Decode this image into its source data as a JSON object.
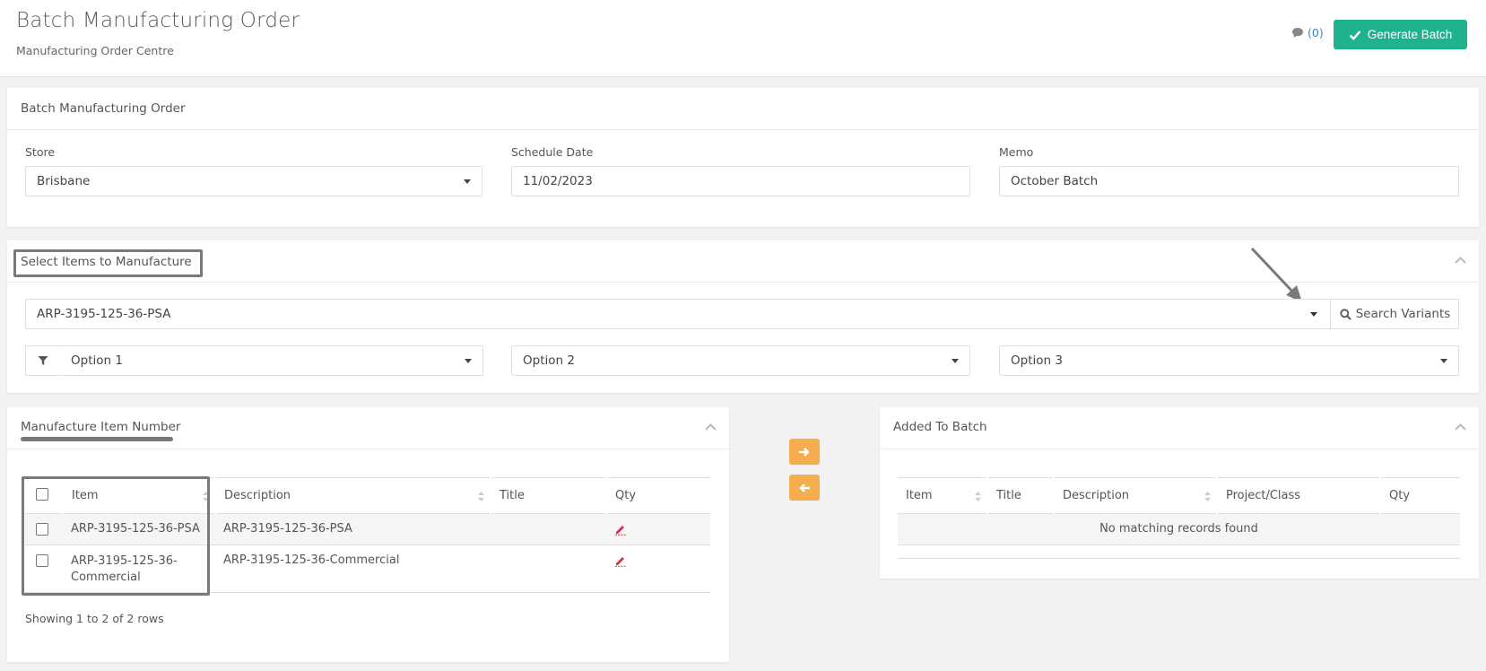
{
  "header": {
    "title": "Batch Manufacturing Order",
    "subtitle": "Manufacturing Order Centre",
    "comments_label": "(0)",
    "generate_label": "Generate Batch"
  },
  "order_panel": {
    "title": "Batch Manufacturing Order",
    "store_label": "Store",
    "store_value": "Brisbane",
    "date_label": "Schedule Date",
    "date_value": "11/02/2023",
    "memo_label": "Memo",
    "memo_value": "October Batch"
  },
  "select_panel": {
    "title": "Select Items to Manufacture",
    "search_value": "ARP-3195-125-36-PSA",
    "search_button": "Search Variants",
    "option1": "Option 1",
    "option2": "Option 2",
    "option3": "Option 3"
  },
  "manufacture_panel": {
    "title": "Manufacture Item Number",
    "columns": [
      "Item",
      "Description",
      "Title",
      "Qty"
    ],
    "rows": [
      {
        "item": "ARP-3195-125-36-PSA",
        "description": "ARP-3195-125-36-PSA",
        "title": ""
      },
      {
        "item": "ARP-3195-125-36-Commercial",
        "description": "ARP-3195-125-36-Commercial",
        "title": ""
      }
    ],
    "footer": "Showing 1 to 2 of 2 rows"
  },
  "batch_panel": {
    "title": "Added To Batch",
    "columns": [
      "Item",
      "Title",
      "Description",
      "Project/Class",
      "Qty"
    ],
    "empty": "No matching records found"
  },
  "colors": {
    "primary": "#1fb28e",
    "accent": "#f6ad4e",
    "link": "#3a87c7",
    "edit": "#d9304f"
  },
  "icons": {
    "comment": "comment-icon",
    "check": "check-icon",
    "search": "search-icon",
    "filter": "filter-icon",
    "edit": "pencil-icon",
    "move_right": "arrow-right-icon",
    "move_left": "arrow-left-icon",
    "collapse": "chevron-up-icon"
  }
}
